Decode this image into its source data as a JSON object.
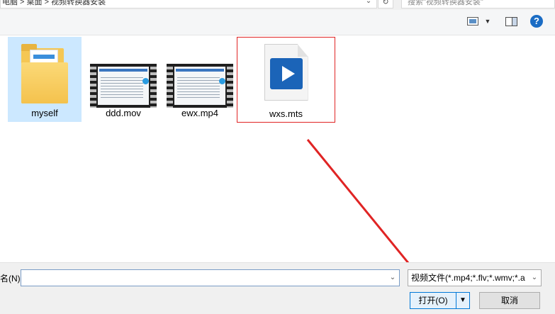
{
  "address_bar": {
    "path": "电脑 > 桌面 > 视频转换器安装"
  },
  "search": {
    "placeholder": "搜索\"视频转换器安装\""
  },
  "toolbar": {
    "help_label": "?"
  },
  "files": [
    {
      "name": "myself",
      "kind": "folder",
      "selected": true
    },
    {
      "name": "ddd.mov",
      "kind": "video"
    },
    {
      "name": "ewx.mp4",
      "kind": "video"
    },
    {
      "name": "wxs.mts",
      "kind": "mts",
      "highlighted": true
    }
  ],
  "bottom": {
    "filename_label": "名(N):",
    "filename_value": "",
    "filetype_value": "视频文件(*.mp4;*.flv;*.wmv;*.a",
    "open_label": "打开(O)",
    "cancel_label": "取消"
  },
  "colors": {
    "annotation": "#e02424",
    "selection": "#cce8ff",
    "accent": "#0078d7"
  }
}
